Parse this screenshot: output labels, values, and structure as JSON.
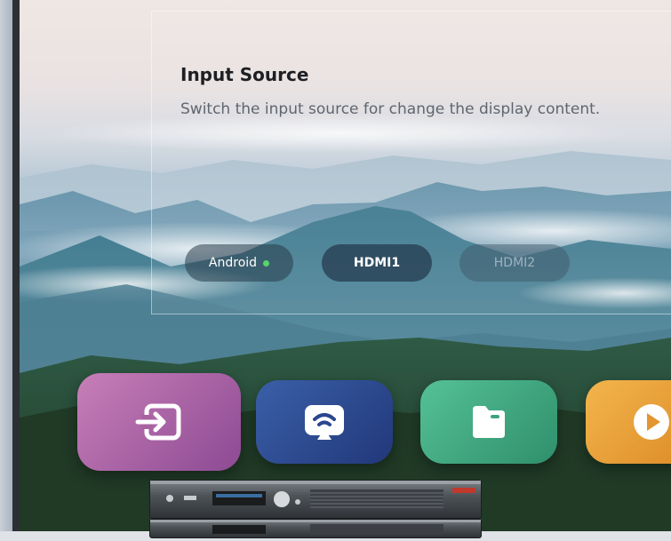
{
  "panel": {
    "title": "Input Source",
    "description": "Switch the input source for change the display content."
  },
  "sources": [
    {
      "label": "Android",
      "active": true
    },
    {
      "label": "HDMI1",
      "active": false
    },
    {
      "label": "HDMI2",
      "active": false
    }
  ],
  "tiles": [
    {
      "name": "input-source",
      "icon": "input-icon",
      "color": "#a05d9e"
    },
    {
      "name": "screen-cast",
      "icon": "cast-icon",
      "color": "#2f4e8c"
    },
    {
      "name": "files",
      "icon": "folder-icon",
      "color": "#3fa37d"
    },
    {
      "name": "media-player",
      "icon": "play-icon",
      "color": "#e8a03a"
    }
  ],
  "colors": {
    "active_indicator": "#55d56a"
  }
}
